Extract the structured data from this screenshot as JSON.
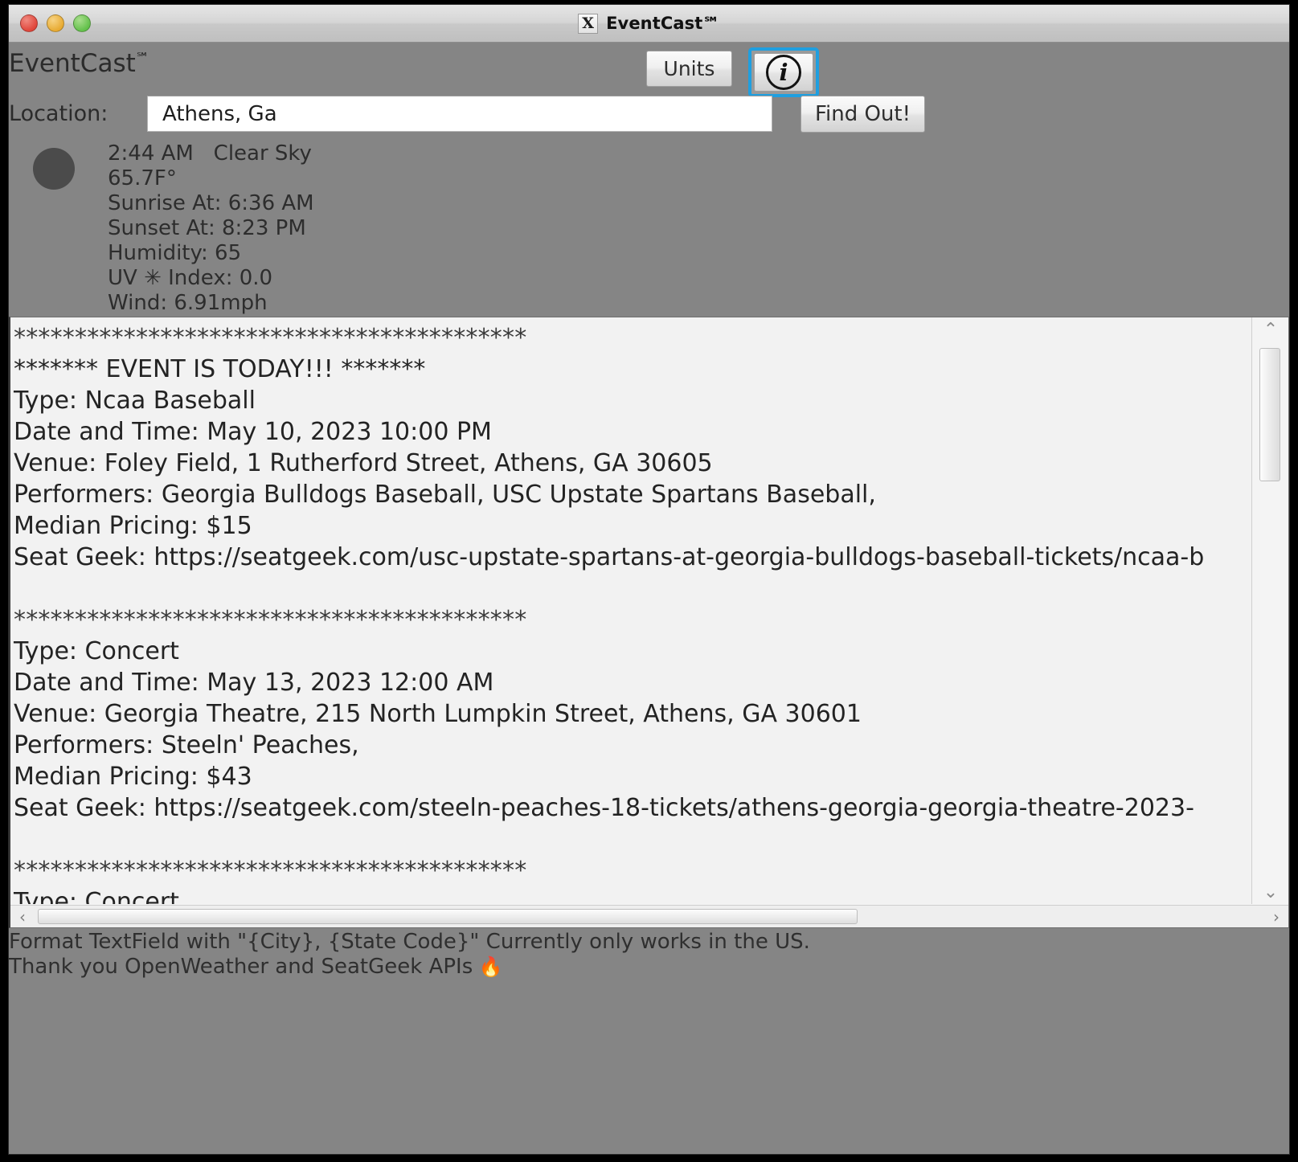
{
  "window": {
    "title": "EventCast℠",
    "icon": "X",
    "traffic_lights": [
      "close",
      "minimize",
      "zoom"
    ]
  },
  "header": {
    "app_name": "EventCast",
    "app_name_suffix": "℠",
    "units_label": "Units",
    "info_label": "i"
  },
  "location": {
    "label": "Location:",
    "value": "Athens, Ga",
    "placeholder": "{City}, {State Code}",
    "find_out_label": "Find Out!"
  },
  "weather": {
    "icon": "clear-night-circle",
    "time": "2:44 AM",
    "condition": "Clear Sky",
    "temperature": "65.7F°",
    "sunrise": "Sunrise At: 6:36 AM",
    "sunset": "Sunset At: 8:23 PM",
    "humidity": "Humidity: 65",
    "uv_index": "UV ✳ Index: 0.0",
    "wind": "Wind: 6.91mph",
    "line1": "2:44 AM   Clear Sky"
  },
  "events_text": {
    "separator": "******************************************",
    "lines": [
      "******************************************",
      "******* EVENT IS TODAY!!! *******",
      "Type: Ncaa Baseball",
      "Date and Time: May 10, 2023 10:00 PM",
      "Venue: Foley Field, 1 Rutherford Street, Athens, GA 30605",
      "Performers: Georgia Bulldogs Baseball, USC Upstate Spartans Baseball,",
      "Median Pricing: $15",
      "Seat Geek: https://seatgeek.com/usc-upstate-spartans-at-georgia-bulldogs-baseball-tickets/ncaa-b",
      "",
      "******************************************",
      "Type: Concert",
      "Date and Time: May 13, 2023 12:00 AM",
      "Venue: Georgia Theatre, 215 North Lumpkin Street, Athens, GA 30601",
      "Performers: Steeln' Peaches,",
      "Median Pricing: $43",
      "Seat Geek: https://seatgeek.com/steeln-peaches-18-tickets/athens-georgia-georgia-theatre-2023-",
      "",
      "******************************************",
      "Type: Concert"
    ],
    "events": [
      {
        "today_banner": "******* EVENT IS TODAY!!! *******",
        "type": "Type: Ncaa Baseball",
        "date_time": "Date and Time: May 10, 2023 10:00 PM",
        "venue": "Venue: Foley Field, 1 Rutherford Street, Athens, GA 30605",
        "performers": "Performers: Georgia Bulldogs Baseball, USC Upstate Spartans Baseball,",
        "median_pricing": "Median Pricing: $15",
        "seat_geek": "Seat Geek: https://seatgeek.com/usc-upstate-spartans-at-georgia-bulldogs-baseball-tickets/ncaa-b"
      },
      {
        "type": "Type: Concert",
        "date_time": "Date and Time: May 13, 2023 12:00 AM",
        "venue": "Venue: Georgia Theatre, 215 North Lumpkin Street, Athens, GA 30601",
        "performers": "Performers: Steeln' Peaches,",
        "median_pricing": "Median Pricing: $43",
        "seat_geek": "Seat Geek: https://seatgeek.com/steeln-peaches-18-tickets/athens-georgia-georgia-theatre-2023-"
      },
      {
        "type": "Type: Concert"
      }
    ]
  },
  "scrollbars": {
    "up_arrow": "⌃",
    "down_arrow": "⌄",
    "left_arrow": "‹",
    "right_arrow": "›"
  },
  "footer": {
    "line1": "Format TextField with \"{City}, {State Code}\" Currently only works in the US.",
    "line2": "Thank you OpenWeather and SeatGeek APIs",
    "flame": "🔥"
  },
  "colors": {
    "window_bg": "#858585",
    "text_area_bg": "#f2f2f2",
    "focus_ring": "#1f9fe0",
    "body_text": "#2d2d2d"
  }
}
